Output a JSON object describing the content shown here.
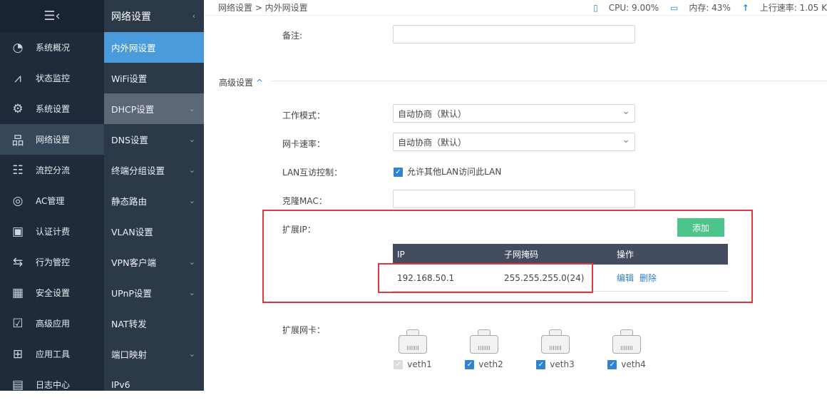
{
  "nav1": {
    "items": [
      {
        "label": "系统概况",
        "icon": "gauge-icon",
        "glyph": "◔"
      },
      {
        "label": "状态监控",
        "icon": "pulse-icon",
        "glyph": "⩘"
      },
      {
        "label": "系统设置",
        "icon": "gear-icon",
        "glyph": "⚙"
      },
      {
        "label": "网络设置",
        "icon": "network-icon",
        "glyph": "品"
      },
      {
        "label": "流控分流",
        "icon": "sliders-icon",
        "glyph": "☷"
      },
      {
        "label": "AC管理",
        "icon": "wifi-icon",
        "glyph": "◎"
      },
      {
        "label": "认证计费",
        "icon": "id-card-icon",
        "glyph": "▣"
      },
      {
        "label": "行为管控",
        "icon": "arrows-icon",
        "glyph": "⇆"
      },
      {
        "label": "安全设置",
        "icon": "firewall-icon",
        "glyph": "▦"
      },
      {
        "label": "高级应用",
        "icon": "checklist-icon",
        "glyph": "☑"
      },
      {
        "label": "应用工具",
        "icon": "apps-icon",
        "glyph": "⊞"
      },
      {
        "label": "日志中心",
        "icon": "log-icon",
        "glyph": "▤"
      }
    ]
  },
  "nav2": {
    "title": "网络设置",
    "items": [
      {
        "label": "内外网设置",
        "chev": ""
      },
      {
        "label": "WiFi设置",
        "chev": ""
      },
      {
        "label": "DHCP设置",
        "chev": "⌄"
      },
      {
        "label": "DNS设置",
        "chev": "⌄"
      },
      {
        "label": "终端分组设置",
        "chev": "⌄"
      },
      {
        "label": "静态路由",
        "chev": "⌄"
      },
      {
        "label": "VLAN设置",
        "chev": ""
      },
      {
        "label": "VPN客户端",
        "chev": "⌄"
      },
      {
        "label": "UPnP设置",
        "chev": "⌄"
      },
      {
        "label": "NAT转发",
        "chev": ""
      },
      {
        "label": "端口映射",
        "chev": "⌄"
      },
      {
        "label": "IPv6",
        "chev": ""
      }
    ]
  },
  "breadcrumb": "网络设置 > 内外网设置",
  "stats": {
    "cpu": "CPU: 9.00%",
    "mem": "内存: 43%",
    "up": "上行速率: 1.05 K"
  },
  "form": {
    "remark_label": "备注:",
    "remark_value": "",
    "advanced": "高级设置",
    "work_mode_label": "工作模式：",
    "work_mode": "自动协商（默认）",
    "speed_label": "网卡速率：",
    "speed": "自动协商（默认）",
    "lan_label": "LAN互访控制：",
    "lan_check": "允许其他LAN访问此LAN",
    "mac_label": "克隆MAC：",
    "mac_value": "",
    "ext_ip_label": "扩展IP：",
    "add": "添加",
    "ext_nic_label": "扩展网卡："
  },
  "table": {
    "headers": [
      "IP",
      "子网掩码",
      "操作"
    ],
    "rows": [
      {
        "ip": "192.168.50.1",
        "mask": "255.255.255.0(24)",
        "edit": "编辑",
        "del": "删除"
      }
    ]
  },
  "ports": [
    {
      "name": "veth1",
      "checked": true,
      "disabled": true
    },
    {
      "name": "veth2",
      "checked": true
    },
    {
      "name": "veth3",
      "checked": true
    },
    {
      "name": "veth4",
      "checked": true
    }
  ],
  "colors": {
    "accent": "#4a9bdb",
    "add": "#4dc48c",
    "highlight": "#e0393e"
  }
}
